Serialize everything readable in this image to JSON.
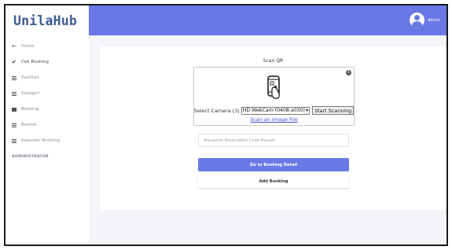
{
  "app": {
    "logo": "UnilaHub"
  },
  "topbar": {
    "user_name": "Admin"
  },
  "sidebar": {
    "items": [
      {
        "label": "Home",
        "icon": "arrow-left-icon",
        "active": false
      },
      {
        "label": "Cek Booking",
        "icon": "check-icon",
        "active": true
      },
      {
        "label": "Fasilitas",
        "icon": "building-icon",
        "active": false
      },
      {
        "label": "Kategori",
        "icon": "list-icon",
        "active": false
      },
      {
        "label": "Booking",
        "icon": "book-icon",
        "active": false
      },
      {
        "label": "Banner",
        "icon": "image-icon",
        "active": false
      },
      {
        "label": "Kalender Booking",
        "icon": "calendar-icon",
        "active": false
      }
    ],
    "section_label": "ADMINISTRATOR"
  },
  "scanner": {
    "title": "Scan QR",
    "camera_label": "Select Camera (3)",
    "camera_value": "HD WebCam (0408:a030)",
    "start_button": "Start Scanning",
    "scan_file_link": "Scan an Image File"
  },
  "form": {
    "reservation_placeholder": "Masukkan Reservation Code Manual",
    "go_button": "Go to Booking Detail",
    "add_button": "Add Booking"
  },
  "colors": {
    "accent": "#6a78e6",
    "logo": "#3d5a93",
    "link": "#3b4fd0"
  }
}
